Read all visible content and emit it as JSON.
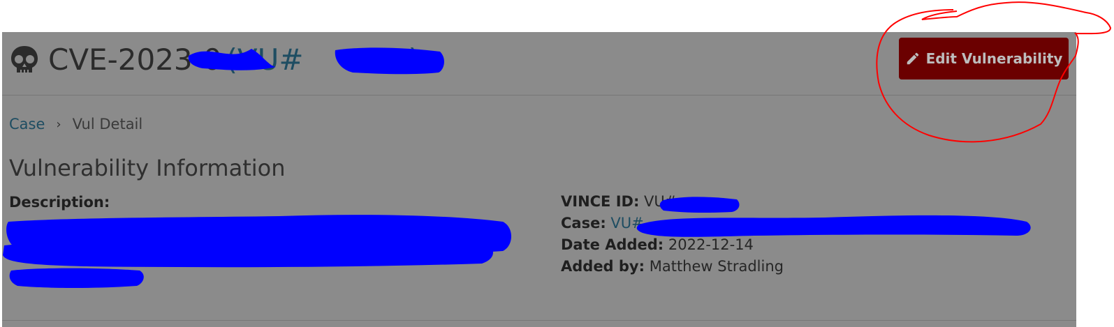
{
  "header": {
    "title_cve": "CVE-2023-0",
    "title_vu": "(VU#",
    "title_close": ")",
    "skull_icon": "skull-icon",
    "edit_button_label": "Edit Vulnerability",
    "edit_icon": "pencil-icon"
  },
  "breadcrumb": {
    "items": [
      {
        "label": "Case"
      },
      {
        "label": "Vul Detail"
      }
    ],
    "separator": "›"
  },
  "vulnerability_information": {
    "heading": "Vulnerability Information",
    "description_label": "Description:",
    "vince_id_label": "VINCE ID:",
    "vince_id_value": "VU#",
    "case_label": "Case:",
    "case_value": "VU#",
    "date_added_label": "Date Added:",
    "date_added_value": "2022-12-14",
    "added_by_label": "Added by:",
    "added_by_value": "Matthew Stradling"
  },
  "colors": {
    "panel_bg": "#8b8b8b",
    "button_bg": "#6b0000",
    "link": "#1e4d62",
    "redaction": "#0000ff",
    "annotation_circle": "#ff0000"
  }
}
